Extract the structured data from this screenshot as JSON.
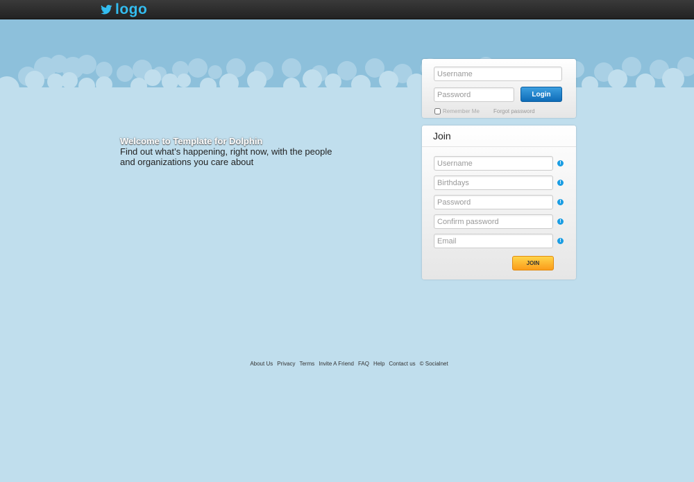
{
  "header": {
    "logo_text": "logo",
    "logo_icon": "twitter-bird-icon",
    "brand_color": "#33bdf0"
  },
  "welcome": {
    "title": "Welcome to Template for Dolphin",
    "subtitle": "Find out what’s happening, right now, with the people and organizations you care about"
  },
  "login": {
    "username_placeholder": "Username",
    "username_value": "",
    "password_placeholder": "Password",
    "password_value": "",
    "login_label": "Login",
    "remember_label": "Remember Me",
    "remember_checked": false,
    "forgot_label": "Forgot password"
  },
  "join": {
    "title": "Join",
    "fields": [
      {
        "placeholder": "Username",
        "value": ""
      },
      {
        "placeholder": "Birthdays",
        "value": ""
      },
      {
        "placeholder": "Password",
        "value": ""
      },
      {
        "placeholder": "Confirm password",
        "value": ""
      },
      {
        "placeholder": "Email",
        "value": ""
      }
    ],
    "info_icon": "info-icon",
    "info_glyph": "!",
    "join_label": "JOIN"
  },
  "footer": {
    "links": [
      "About Us",
      "Privacy",
      "Terms",
      "Invite A Friend",
      "FAQ",
      "Help",
      "Contact us"
    ],
    "copyright": "© Socialnet"
  },
  "colors": {
    "background": "#c0deed",
    "sky": "#8dc0db",
    "login_button": "#1a7fcb",
    "join_button": "#fcb52f",
    "info_icon": "#1a9de3"
  }
}
